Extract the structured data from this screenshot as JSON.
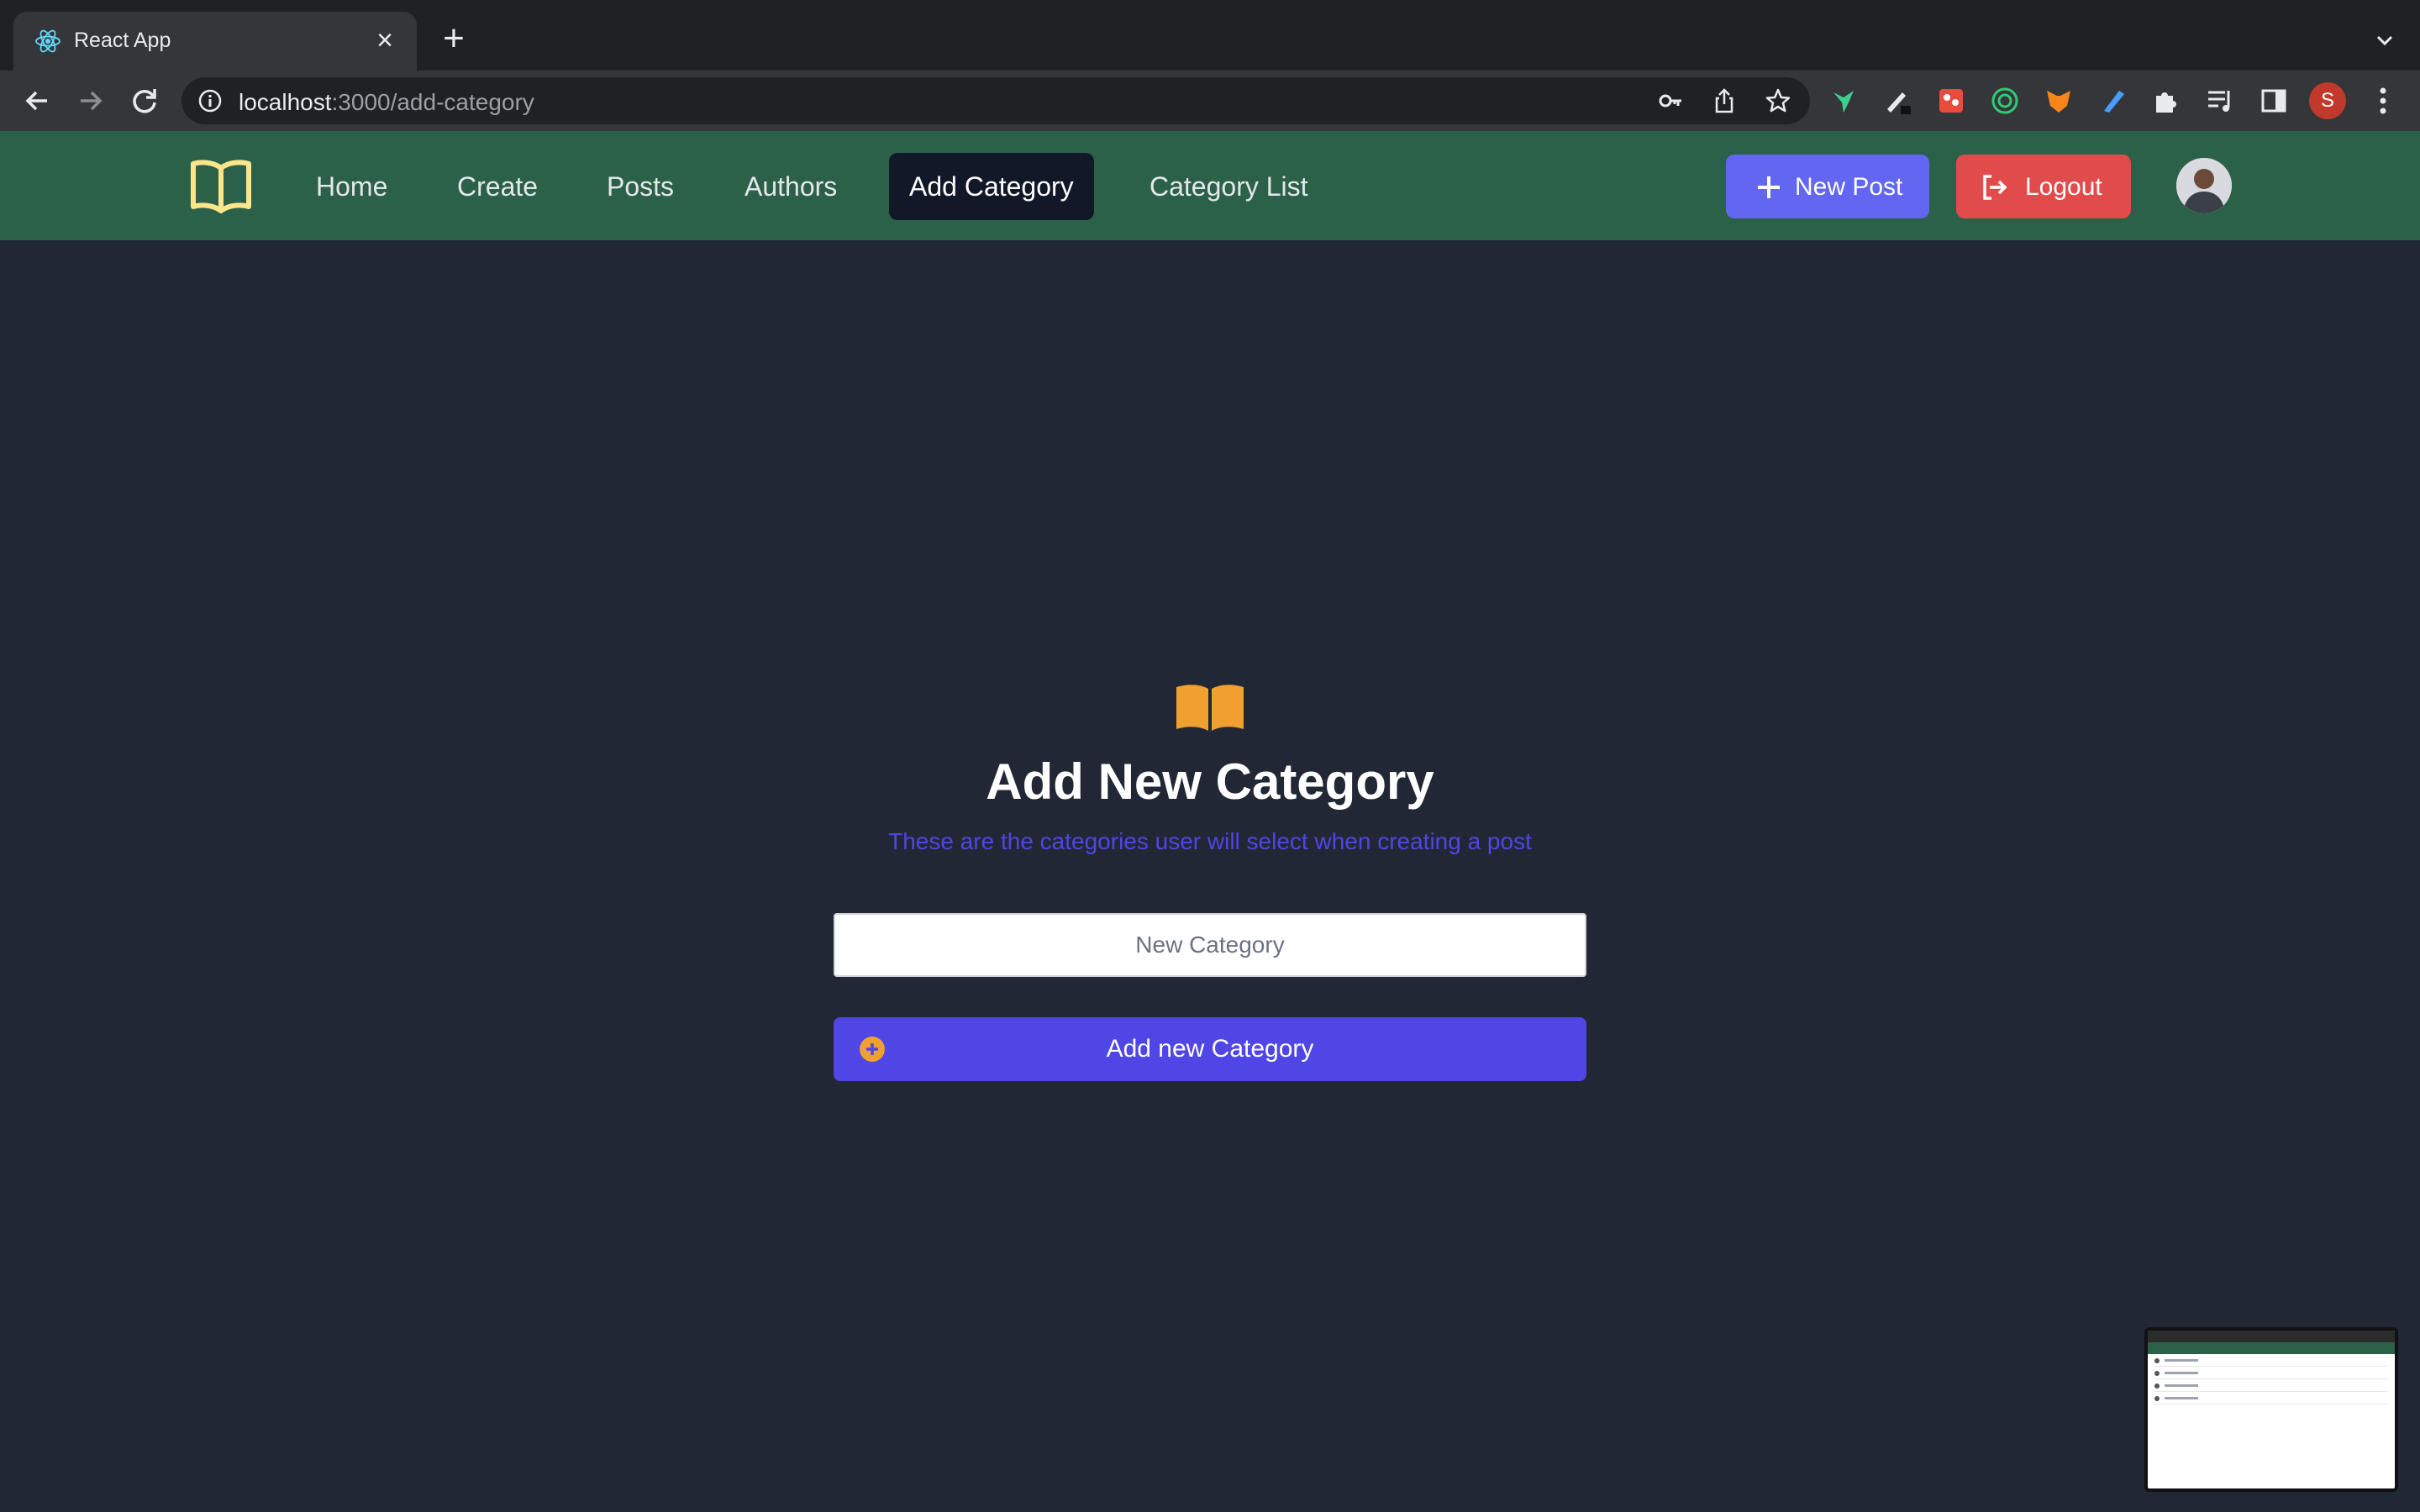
{
  "browser": {
    "tab_title": "React App",
    "tab_close": "×",
    "new_tab": "+",
    "url_host": "localhost",
    "url_path": ":3000/add-category",
    "profile_initial": "S"
  },
  "navbar": {
    "links": [
      {
        "label": "Home"
      },
      {
        "label": "Create"
      },
      {
        "label": "Posts"
      },
      {
        "label": "Authors"
      },
      {
        "label": "Add Category",
        "active": true
      },
      {
        "label": "Category List"
      }
    ],
    "new_post_label": "New Post",
    "logout_label": "Logout"
  },
  "form": {
    "title": "Add New Category",
    "subtitle": "These are the categories user will select when creating a post",
    "input_placeholder": "New Category",
    "input_value": "",
    "submit_label": "Add new Category"
  },
  "colors": {
    "navbar": "#2c6149",
    "background": "#222735",
    "accent": "#4f46e5",
    "new_post": "#6366f1",
    "logout": "#e14b4b",
    "icon_accent": "#f0a030",
    "logo": "#fde68a"
  }
}
